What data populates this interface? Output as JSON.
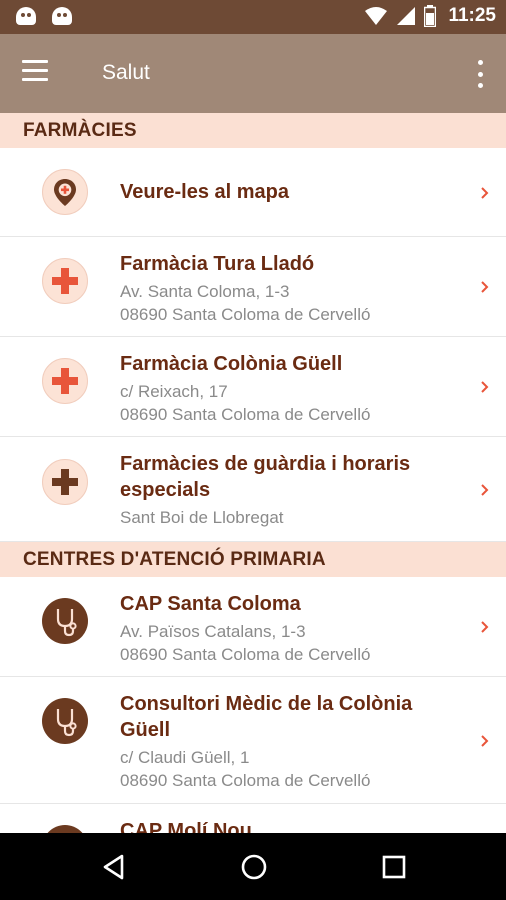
{
  "status_bar": {
    "time": "11:25"
  },
  "app_bar": {
    "title": "Salut"
  },
  "sections": {
    "farmacies": {
      "header": "FARMÀCIES",
      "items": [
        {
          "title": "Veure-les al mapa"
        },
        {
          "title": "Farmàcia Tura Lladó",
          "line1": "Av. Santa Coloma, 1-3",
          "line2": "08690 Santa Coloma de Cervelló"
        },
        {
          "title": "Farmàcia Colònia Güell",
          "line1": "c/ Reixach, 17",
          "line2": "08690 Santa Coloma de Cervelló"
        },
        {
          "title1": "Farmàcies de guàrdia i horaris",
          "title2": "especials",
          "line1": "Sant Boi de Llobregat"
        }
      ]
    },
    "caps": {
      "header": "CENTRES D'ATENCIÓ PRIMARIA",
      "items": [
        {
          "title": "CAP Santa Coloma",
          "line1": "Av. Països Catalans, 1-3",
          "line2": "08690 Santa Coloma de Cervelló"
        },
        {
          "title1": "Consultori Mèdic de la Colònia",
          "title2": "Güell",
          "line1": "c/ Claudi Güell, 1",
          "line2": "08690 Santa Coloma de Cervelló"
        },
        {
          "title": "CAP Molí Nou"
        }
      ]
    }
  },
  "colors": {
    "accent": "#6a2b12",
    "red_cross": "#e8553a",
    "app_bar": "#a08877",
    "status_bar": "#6e4a35",
    "section_bg": "#fbe0d3"
  }
}
